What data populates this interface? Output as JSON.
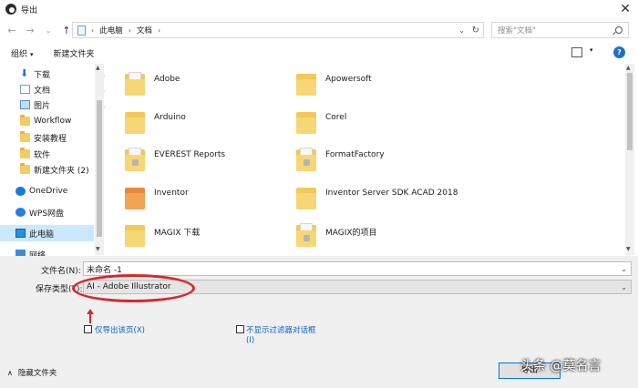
{
  "window": {
    "title": "导出",
    "close_glyph": "✕"
  },
  "nav_buttons": {
    "back": "←",
    "forward": "→",
    "recent": "⌄",
    "up": "↑"
  },
  "address": {
    "crumbs": [
      "此电脑",
      "文档"
    ],
    "separator": "›",
    "dropdown": "⌄",
    "refresh": "↻"
  },
  "search": {
    "placeholder": "搜索\"文档\""
  },
  "toolbar": {
    "organize_label": "组织",
    "organize_caret": "▾",
    "new_folder_label": "新建文件夹",
    "view_caret": "▾",
    "help_label": "?"
  },
  "sidebar": {
    "pin_glyph": "📌",
    "items": [
      {
        "label": "下载",
        "icon": "download-icon"
      },
      {
        "label": "文档",
        "icon": "documents-icon"
      },
      {
        "label": "图片",
        "icon": "pictures-icon"
      },
      {
        "label": "Workflow",
        "icon": "folder-icon"
      },
      {
        "label": "安装教程",
        "icon": "folder-icon"
      },
      {
        "label": "软件",
        "icon": "folder-icon"
      },
      {
        "label": "新建文件夹 (2)",
        "icon": "folder-icon"
      },
      {
        "label": "OneDrive",
        "icon": "onedrive-icon"
      },
      {
        "label": "WPS网盘",
        "icon": "wps-cloud-icon"
      },
      {
        "label": "此电脑",
        "icon": "this-pc-icon"
      },
      {
        "label": "网络",
        "icon": "network-icon"
      }
    ],
    "selected": "此电脑"
  },
  "files": {
    "items": [
      {
        "name": "Adobe"
      },
      {
        "name": "Apowersoft"
      },
      {
        "name": "Arduino"
      },
      {
        "name": "Corel"
      },
      {
        "name": "EVEREST Reports"
      },
      {
        "name": "FormatFactory"
      },
      {
        "name": "Inventor"
      },
      {
        "name": "Inventor Server SDK ACAD 2018"
      },
      {
        "name": "MAGIX 下载"
      },
      {
        "name": "MAGIX的项目"
      }
    ]
  },
  "save_form": {
    "filename_label": "文件名(N):",
    "filename_value": "未命名 -1",
    "filetype_label": "保存类型(T):",
    "filetype_value": "AI - Adobe Illustrator",
    "dropdown_glyph": "⌄",
    "option_export_page": "仅导出该页(X)",
    "option_no_filter_line1": "不显示过滤器对话框",
    "option_no_filter_line2": "(I)",
    "hide_folders_label": "隐藏文件夹",
    "hide_folders_chevron": "∧",
    "export_button_label": "导出"
  },
  "watermark": {
    "text": "头条 @莫名言"
  },
  "colors": {
    "annotation": "#d42a2a",
    "link": "#0b5ec9",
    "selection": "#cce8ff",
    "folder": "#f3c858"
  }
}
